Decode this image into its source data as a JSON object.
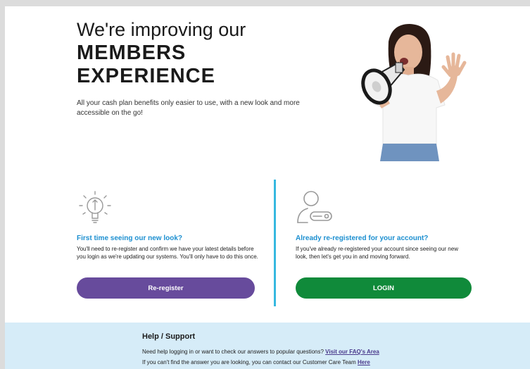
{
  "hero": {
    "line1": "We're improving our",
    "line2": "MEMBERS",
    "line3": "EXPERIENCE",
    "description": "All your cash plan benefits only easier to use, with a new look and more accessible on the go!"
  },
  "first_time": {
    "icon": "lightbulb-icon",
    "title": "First time seeing our new look?",
    "text": "You'll need to re-register and confirm we have your latest details before you login as we're updating our systems. You'll only have to do this once.",
    "button_label": "Re-register"
  },
  "registered": {
    "icon": "user-key-icon",
    "title": "Already re-registered for your account?",
    "text": "If you've already re-registered your account since seeing our new look, then let's get you in and moving forward.",
    "button_label": "LOGIN"
  },
  "support": {
    "title": "Help / Support",
    "line1_text": "Need help logging in or want to check our answers to popular questions?",
    "line1_link": "Visit our FAQ's Area",
    "line2_text": "If you can't find the answer you are looking, you can contact our Customer Care Team",
    "line2_link": "Here"
  },
  "colors": {
    "accent_blue": "#1c8fd0",
    "divider": "#36b8e0",
    "reregister_button": "#674b9c",
    "login_button": "#108a3a",
    "support_bg": "#d6ecf8"
  }
}
